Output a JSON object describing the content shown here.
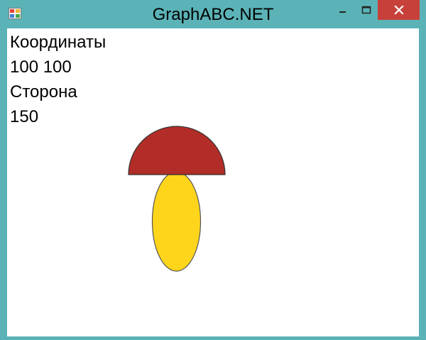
{
  "window": {
    "title": "GraphABC.NET",
    "icon": "graphabc-app-icon",
    "controls": [
      "minimize-icon",
      "maximize-icon",
      "close-icon"
    ],
    "frame_color": "#5bb3b7",
    "close_color": "#c7413a"
  },
  "client": {
    "lines": [
      "Координаты",
      "100 100",
      "Сторона",
      "150"
    ]
  },
  "drawing": {
    "shapes": [
      "mushroom-cap",
      "mushroom-stem"
    ],
    "cap_color": "#b22d27",
    "stem_color": "#ffd51c",
    "outline_color": "#555555"
  }
}
